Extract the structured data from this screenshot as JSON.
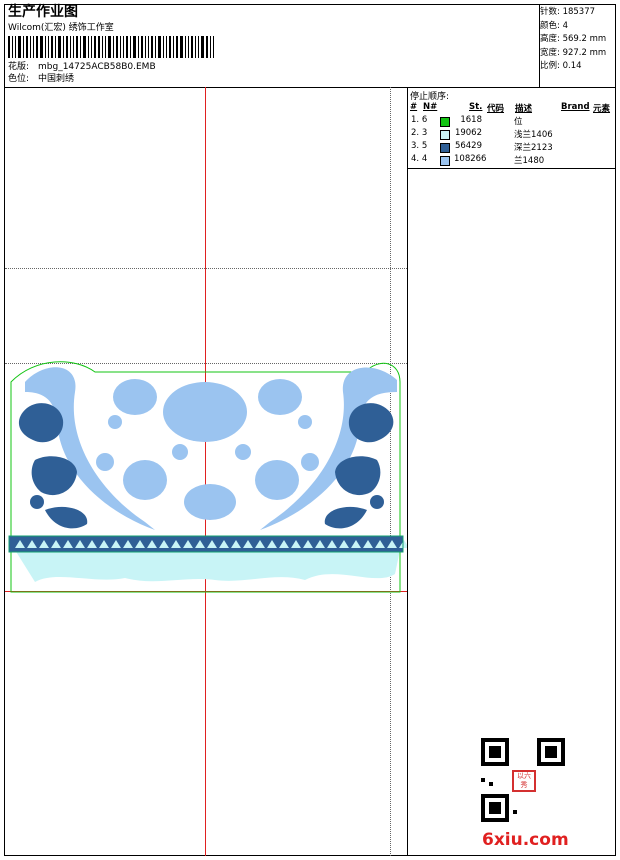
{
  "header": {
    "title": "生产作业图",
    "subtitle": "Wilcom(汇宏) 绣饰工作室",
    "design_label": "花版:",
    "design_file": "mbg_14725ACB58B0.EMB",
    "color_label": "色位:",
    "color_value": "中国刺绣"
  },
  "specs": [
    {
      "label": "针数:",
      "value": "185377"
    },
    {
      "label": "颜色:",
      "value": "4"
    },
    {
      "label": "高度:",
      "value": "569.2 mm"
    },
    {
      "label": "宽度:",
      "value": "927.2 mm"
    },
    {
      "label": "比例:",
      "value": "0.14"
    }
  ],
  "stop_sequence": {
    "title": "停止顺序:",
    "columns": {
      "hash": "#",
      "no": "N#",
      "st": "St.",
      "code": "代码",
      "desc": "描述",
      "brand": "Brand",
      "element": "元素"
    },
    "rows": [
      {
        "idx": "1.",
        "n": "6",
        "color": "#13c413",
        "stitches": "1618",
        "desc": "位"
      },
      {
        "idx": "2.",
        "n": "3",
        "color": "#c8f4f6",
        "stitches": "19062",
        "desc": "浅兰1406"
      },
      {
        "idx": "3.",
        "n": "5",
        "color": "#2f5f96",
        "stitches": "56429",
        "desc": "深兰2123"
      },
      {
        "idx": "4.",
        "n": "4",
        "color": "#9bc4f0",
        "stitches": "108266",
        "desc": "兰1480"
      }
    ]
  },
  "watermark": {
    "site": "6xiu.com",
    "stamp": "以六秀"
  }
}
